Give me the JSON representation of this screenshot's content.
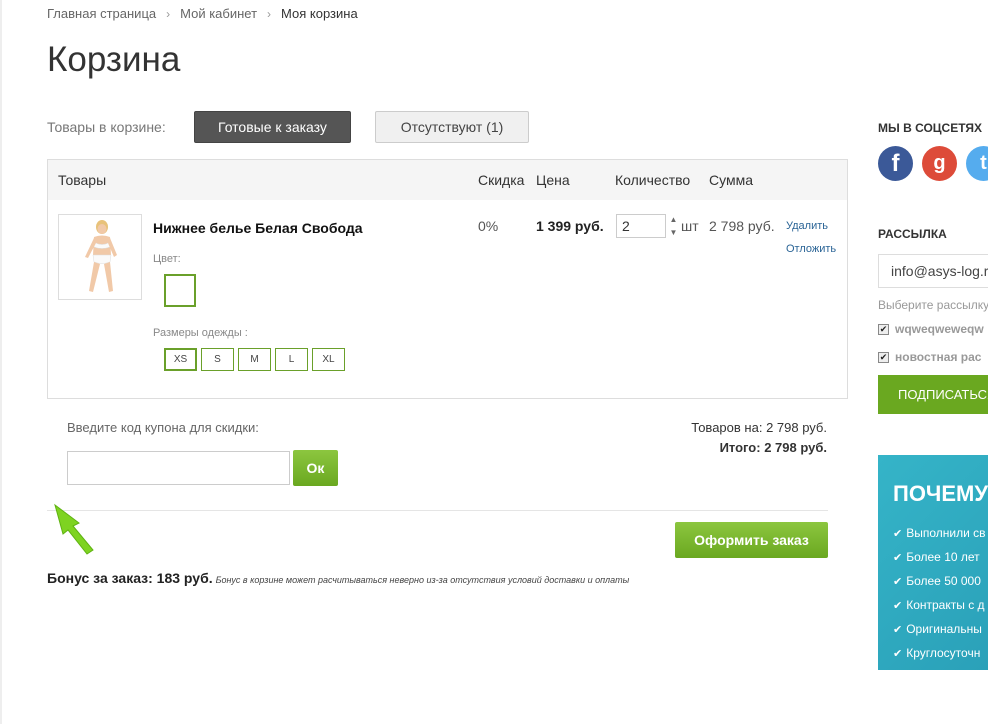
{
  "breadcrumb": {
    "items": [
      "Главная страница",
      "Мой кабинет",
      "Моя корзина"
    ]
  },
  "page_title": "Корзина",
  "tabs": {
    "label": "Товары в корзине:",
    "ready": "Готовые к заказу",
    "absent": "Отсутствуют (1)"
  },
  "table": {
    "headers": {
      "goods": "Товары",
      "discount": "Скидка",
      "price": "Цена",
      "qty": "Количество",
      "sum": "Сумма"
    }
  },
  "item": {
    "name": "Нижнее белье Белая Свобода",
    "color_label": "Цвет:",
    "size_label": "Размеры одежды :",
    "sizes": [
      "XS",
      "S",
      "M",
      "L",
      "XL"
    ],
    "discount": "0%",
    "price": "1 399 руб.",
    "qty": "2",
    "unit": "шт",
    "sum": "2 798 руб.",
    "delete": "Удалить",
    "postpone": "Отложить"
  },
  "coupon": {
    "label": "Введите код купона для скидки:",
    "button": "Ок"
  },
  "totals": {
    "goods_label": "Товаров на:",
    "goods_value": "2 798 руб.",
    "total_label": "Итого:",
    "total_value": "2 798 руб."
  },
  "order_button": "Оформить заказ",
  "bonus": {
    "label": "Бонус за заказ: 183 руб.",
    "note": "Бонус в корзине может расчитываться неверно из-за отсутствия условий доставки и оплаты"
  },
  "sidebar": {
    "social_title": "МЫ В СОЦСЕТЯХ",
    "mailing_title": "РАССЫЛКА",
    "email_value": "info@asys-log.r",
    "choose_text": "Выберите рассылку",
    "options": [
      "wqweqweweqw",
      "новостная рас"
    ],
    "subscribe": "ПОДПИСАТЬСЯ",
    "why_title": "ПОЧЕМУ",
    "why_items": [
      "Выполнили св",
      "Более 10 лет",
      "Более 50 000",
      "Контракты с д",
      "Оригинальны",
      "Круглосуточн"
    ]
  },
  "colors": {
    "green": "#6aa820",
    "dark_tab": "#555555",
    "teal": "#35b4c8"
  }
}
